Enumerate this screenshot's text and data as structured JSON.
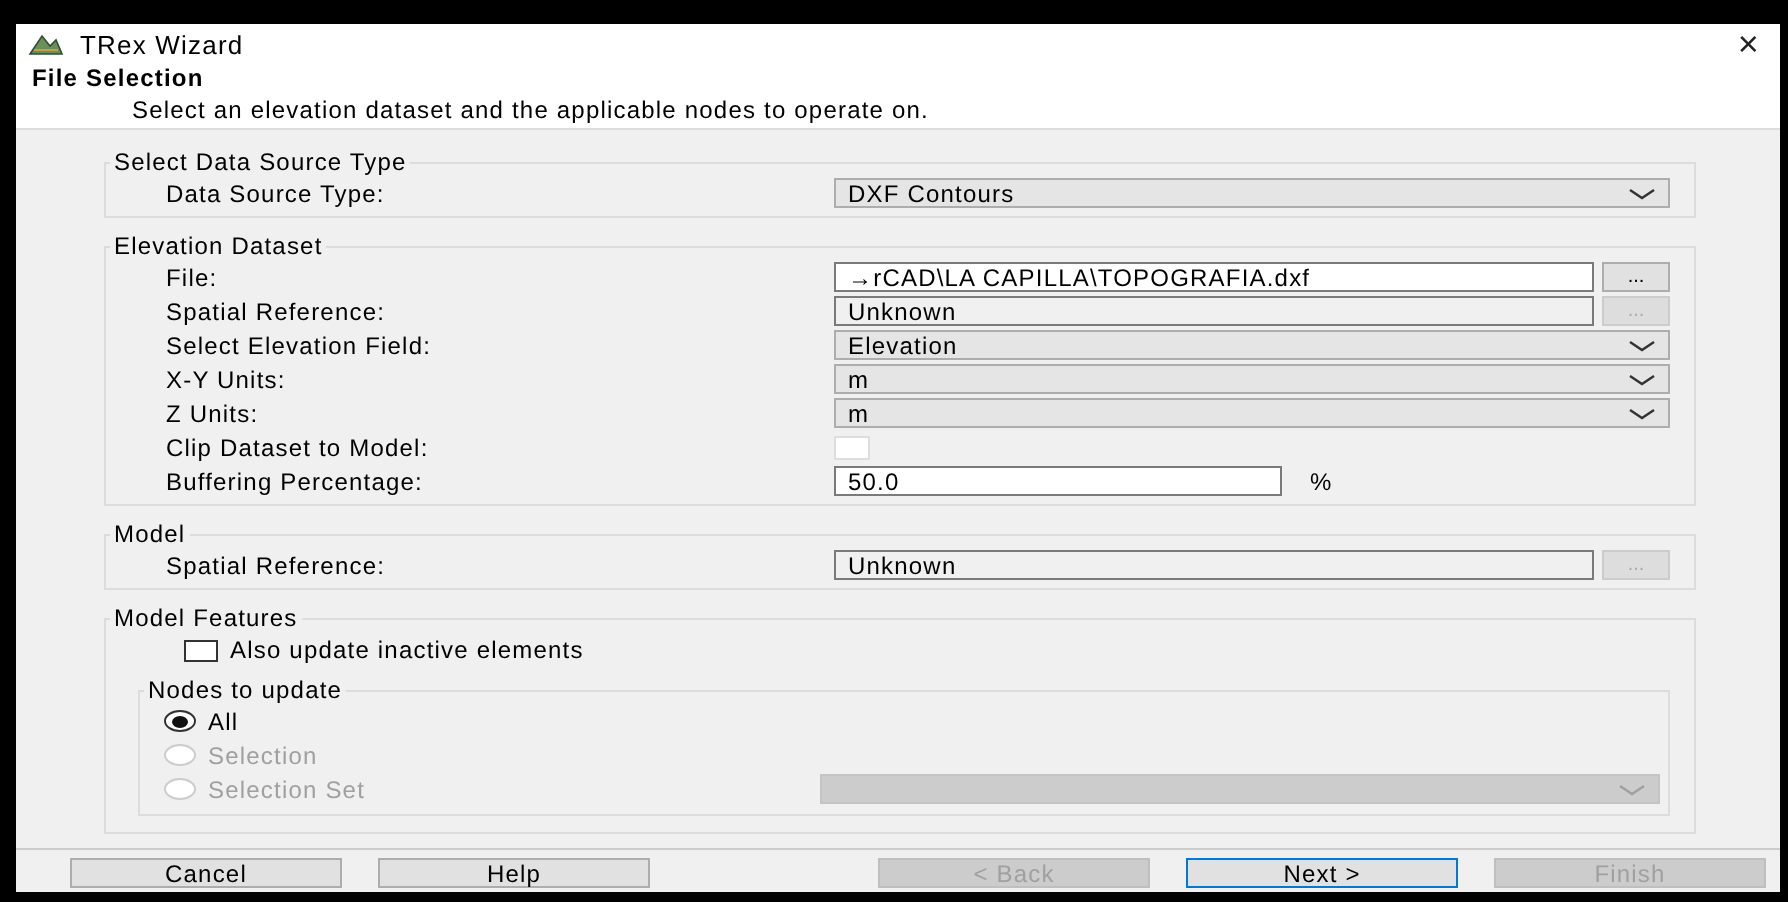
{
  "window": {
    "title": "TRex Wizard",
    "close": "×"
  },
  "header": {
    "title": "File Selection",
    "subtitle": "Select an elevation dataset and the applicable nodes to operate on."
  },
  "groups": [
    {
      "title": "Select Data Source Type",
      "rows": [
        {
          "label": "Data Source Type:",
          "kind": "dropdown",
          "value": "DXF Contours"
        }
      ]
    },
    {
      "title": "Elevation Dataset",
      "rows": [
        {
          "label": "File:",
          "kind": "file",
          "value": "→rCAD\\LA CAPILLA\\TOPOGRAFIA.dxf",
          "browse": "...",
          "browse_disabled": false
        },
        {
          "label": "Spatial Reference:",
          "kind": "file",
          "value": "Unknown",
          "browse": "...",
          "browse_disabled": true
        },
        {
          "label": "Select Elevation Field:",
          "kind": "dropdown",
          "value": "Elevation"
        },
        {
          "label": "X-Y Units:",
          "kind": "dropdown",
          "value": "m"
        },
        {
          "label": "Z Units:",
          "kind": "dropdown",
          "value": "m"
        },
        {
          "label": "Clip Dataset to Model:",
          "kind": "checkbox",
          "checked": false
        },
        {
          "label": "Buffering Percentage:",
          "kind": "number",
          "value": "50.0",
          "suffix": "%"
        }
      ]
    },
    {
      "title": "Model",
      "rows": [
        {
          "label": "Spatial Reference:",
          "kind": "file",
          "value": "Unknown",
          "browse": "...",
          "browse_disabled": true
        }
      ]
    }
  ],
  "model_features": {
    "title": "Model Features",
    "checkbox": {
      "label": "Also update inactive elements",
      "checked": false
    },
    "nodes": {
      "title": "Nodes to update",
      "options": [
        {
          "label": "All",
          "selected": true,
          "disabled": false
        },
        {
          "label": "Selection",
          "selected": false,
          "disabled": true
        },
        {
          "label": "Selection Set",
          "selected": false,
          "disabled": true,
          "dropdown_disabled": true
        }
      ]
    }
  },
  "buttons": [
    {
      "label": "Cancel",
      "disabled": false,
      "default": false
    },
    {
      "label": "Help",
      "disabled": false,
      "default": false
    },
    {
      "label": "< Back",
      "disabled": true,
      "default": false
    },
    {
      "label": "Next >",
      "disabled": false,
      "default": true
    },
    {
      "label": "Finish",
      "disabled": true,
      "default": false
    }
  ]
}
